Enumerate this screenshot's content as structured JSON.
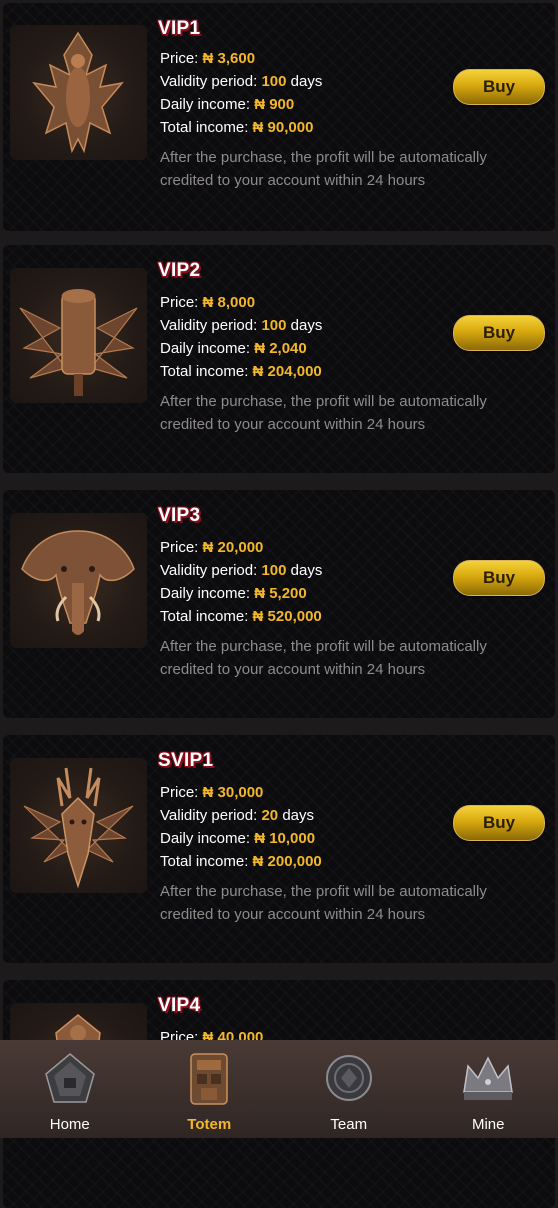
{
  "currency": "₦",
  "labels": {
    "price": "Price:",
    "validity": "Validity period:",
    "validity_unit": "days",
    "daily": "Daily income:",
    "total": "Total income:"
  },
  "products": [
    {
      "name": "VIP1",
      "price": "₦ 3,600",
      "validity": "100",
      "daily": "₦ 900",
      "total": "₦ 90,000",
      "note": "After the purchase, the profit will be automatically credited to your account within 24 hours",
      "button": "Buy",
      "icon": "lizard-totem-icon"
    },
    {
      "name": "VIP2",
      "price": "₦ 8,000",
      "validity": "100",
      "daily": "₦ 2,040",
      "total": "₦ 204,000",
      "note": "After the purchase, the profit will be automatically credited to your account within 24 hours",
      "button": "Buy",
      "icon": "drum-totem-icon"
    },
    {
      "name": "VIP3",
      "price": "₦ 20,000",
      "validity": "100",
      "daily": "₦ 5,200",
      "total": "₦ 520,000",
      "note": "After the purchase, the profit will be automatically credited to your account within 24 hours",
      "button": "Buy",
      "icon": "elephant-totem-icon"
    },
    {
      "name": "SVIP1",
      "price": "₦ 30,000",
      "validity": "20",
      "daily": "₦ 10,000",
      "total": "₦ 200,000",
      "note": "After the purchase, the profit will be automatically credited to your account within 24 hours",
      "button": "Buy",
      "icon": "antelope-totem-icon"
    },
    {
      "name": "VIP4",
      "price": "₦ 40,000",
      "icon": "mask-totem-icon"
    }
  ],
  "nav": [
    {
      "label": "Home",
      "icon": "home-icon",
      "active": false
    },
    {
      "label": "Totem",
      "icon": "totem-icon",
      "active": true
    },
    {
      "label": "Team",
      "icon": "team-icon",
      "active": false
    },
    {
      "label": "Mine",
      "icon": "crown-icon",
      "active": false
    }
  ],
  "colors": {
    "accent": "#f3b72a",
    "button": "#e0b31a",
    "title_shadow": "#8a0d1d",
    "note": "#8e8b8a"
  }
}
